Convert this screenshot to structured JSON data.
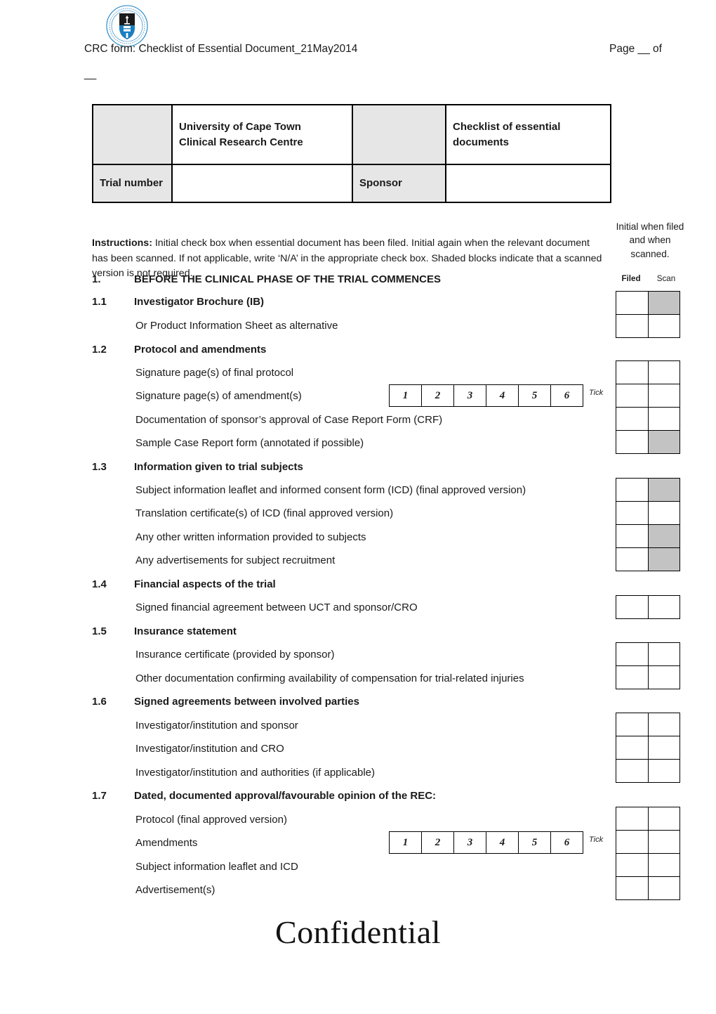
{
  "header": {
    "logo_alt": "University of Cape Town seal",
    "title": "CRC form: Checklist of Essential Document_21May2014",
    "page_label": "Page __ of",
    "page_continued": "__"
  },
  "id_table": {
    "cell_blank_1": "",
    "org_name": "University of Cape Town\nClinical Research Centre",
    "org_name_line1": "University of Cape Town",
    "org_name_line2": "Clinical Research Centre",
    "cell_blank_2": "",
    "doc_title_line1": "Checklist of essential",
    "doc_title_line2": "documents",
    "trial_number_label": "Trial number",
    "trial_number_value": "",
    "sponsor_label": "Sponsor",
    "sponsor_value": ""
  },
  "instructions": {
    "bold_prefix": "Instructions:",
    "text": " Initial check box when essential document has been filed.  Initial again when the relevant document has been scanned.  If not applicable, write ‘N/A’ in the appropriate check box.  Shaded blocks indicate that a scanned version is not required."
  },
  "right_note": {
    "text": "Initial when filed and when scanned.",
    "col_filed": "Filed",
    "col_scan": "Scan"
  },
  "section": {
    "number": "1.",
    "title": "BEFORE THE CLINICAL PHASE OF THE TRIAL COMMENCES"
  },
  "subsections": [
    {
      "number": "1.1",
      "title": "Investigator Brochure (IB)",
      "items": [
        {
          "label": "Investigator Brochure (IB)",
          "is_heading_row": true,
          "scan_shaded": true
        },
        {
          "label": "Or Product Information Sheet as alternative",
          "is_heading_row": false,
          "scan_shaded": false
        }
      ]
    },
    {
      "number": "1.2",
      "title": "Protocol and amendments",
      "items": [
        {
          "label": "Signature page(s) of final protocol",
          "is_heading_row": false,
          "scan_shaded": false
        },
        {
          "label": "Signature page(s) of amendment(s)",
          "is_heading_row": false,
          "scan_shaded": false,
          "tick_strip": true
        },
        {
          "label": "Documentation of sponsor’s approval of Case Report Form (CRF)",
          "is_heading_row": false,
          "scan_shaded": false
        },
        {
          "label": "Sample Case Report form (annotated if possible)",
          "is_heading_row": false,
          "scan_shaded": true
        }
      ]
    },
    {
      "number": "1.3",
      "title": "Information given to trial subjects",
      "items": [
        {
          "label": "Subject information leaflet and informed consent form (ICD) (final approved version)",
          "is_heading_row": false,
          "scan_shaded": true
        },
        {
          "label": "Translation certificate(s) of ICD (final approved version)",
          "is_heading_row": false,
          "scan_shaded": false
        },
        {
          "label": "Any other written information provided to subjects",
          "is_heading_row": false,
          "scan_shaded": true
        },
        {
          "label": "Any advertisements for subject recruitment",
          "is_heading_row": false,
          "scan_shaded": true
        }
      ]
    },
    {
      "number": "1.4",
      "title": "Financial aspects of the trial",
      "items": [
        {
          "label": "Signed financial agreement between UCT and sponsor/CRO",
          "is_heading_row": false,
          "scan_shaded": false
        }
      ]
    },
    {
      "number": "1.5",
      "title": "Insurance statement",
      "items": [
        {
          "label": "Insurance certificate (provided by sponsor)",
          "is_heading_row": false,
          "scan_shaded": false
        },
        {
          "label": "Other documentation confirming availability of compensation for trial-related injuries",
          "is_heading_row": false,
          "scan_shaded": false
        }
      ]
    },
    {
      "number": "1.6",
      "title": "Signed agreements between involved parties",
      "items": [
        {
          "label": "Investigator/institution and sponsor",
          "is_heading_row": false,
          "scan_shaded": false
        },
        {
          "label": "Investigator/institution and CRO",
          "is_heading_row": false,
          "scan_shaded": false
        },
        {
          "label": "Investigator/institution and authorities (if applicable)",
          "is_heading_row": false,
          "scan_shaded": false
        }
      ]
    },
    {
      "number": "1.7",
      "title": "Dated, documented approval/favourable opinion of the REC:",
      "items": [
        {
          "label": "Protocol (final approved version)",
          "is_heading_row": false,
          "scan_shaded": false
        },
        {
          "label": "Amendments",
          "is_heading_row": false,
          "scan_shaded": false,
          "tick_strip": true
        },
        {
          "label": "Subject information leaflet and ICD",
          "is_heading_row": false,
          "scan_shaded": false
        },
        {
          "label": "Advertisement(s)",
          "is_heading_row": false,
          "scan_shaded": false
        }
      ]
    }
  ],
  "tick_strips": [
    {
      "id": "amendments-signature-pages",
      "numbers": [
        "1",
        "2",
        "3",
        "4",
        "5",
        "6"
      ],
      "label": "Tick"
    },
    {
      "id": "amendments-rec-approval",
      "numbers": [
        "1",
        "2",
        "3",
        "4",
        "5",
        "6"
      ],
      "label": "Tick"
    }
  ],
  "watermark": {
    "text": "Confidential"
  },
  "colors": {
    "table_shade": "#e6e6e6",
    "checkbox_shade": "#c3c3c3",
    "text": "#1a1a1a",
    "logo_blue": "#1a7fc1"
  }
}
